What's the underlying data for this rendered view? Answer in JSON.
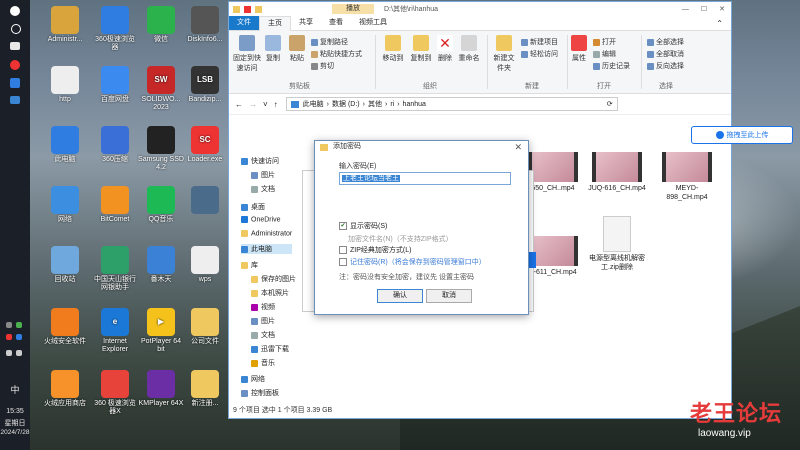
{
  "desktop_icons": [
    {
      "label": "Administr...",
      "color": "#d9a43b",
      "glyph": ""
    },
    {
      "label": "360极速浏览器",
      "color": "#2f7de1",
      "glyph": ""
    },
    {
      "label": "微信",
      "color": "#2bb24c",
      "glyph": ""
    },
    {
      "label": "DiskInfo6...",
      "color": "#555",
      "glyph": ""
    },
    {
      "label": "http",
      "color": "#eee",
      "glyph": ""
    },
    {
      "label": "百度网盘",
      "color": "#3b8af0",
      "glyph": ""
    },
    {
      "label": "SOLIDWO... 2023",
      "color": "#c62828",
      "glyph": "SW"
    },
    {
      "label": "Bandizip...",
      "color": "#333",
      "glyph": "LSB"
    },
    {
      "label": "此电脑",
      "color": "#2f7de1",
      "glyph": ""
    },
    {
      "label": "360压缩",
      "color": "#3a6fd8",
      "glyph": ""
    },
    {
      "label": "Samsung SSD 4.2",
      "color": "#222",
      "glyph": ""
    },
    {
      "label": "Loader.exe",
      "color": "#e33",
      "glyph": "SC"
    },
    {
      "label": "网络",
      "color": "#3c8ee0",
      "glyph": ""
    },
    {
      "label": "BitComet",
      "color": "#f29220",
      "glyph": ""
    },
    {
      "label": "QQ音乐",
      "color": "#1db954",
      "glyph": ""
    },
    {
      "label": "",
      "color": "#4a6b8a",
      "glyph": ""
    },
    {
      "label": "回收站",
      "color": "#6fa8dc",
      "glyph": ""
    },
    {
      "label": "中国天山银行网银助手",
      "color": "#2da06a",
      "glyph": ""
    },
    {
      "label": "番木天",
      "color": "#3b82d6",
      "glyph": ""
    },
    {
      "label": "wps",
      "color": "#eee",
      "glyph": ""
    },
    {
      "label": "火绒安全软件",
      "color": "#f07c1e",
      "glyph": ""
    },
    {
      "label": "Internet Explorer",
      "color": "#1b78d6",
      "glyph": "e"
    },
    {
      "label": "PotPlayer 64 bit",
      "color": "#f4c21b",
      "glyph": "▶"
    },
    {
      "label": "公司文件",
      "color": "#f0c860",
      "glyph": ""
    },
    {
      "label": "火绒应用商店",
      "color": "#f7922b",
      "glyph": ""
    },
    {
      "label": "360 极速浏览器X",
      "color": "#e8433a",
      "glyph": ""
    },
    {
      "label": "KMPlayer 64X",
      "color": "#6c2ea5",
      "glyph": ""
    },
    {
      "label": "新注册...",
      "color": "#f0c860",
      "glyph": ""
    }
  ],
  "taskbar": {
    "lang": "中",
    "time": "15:35",
    "weekday": "星期日",
    "date": "2024/7/28"
  },
  "explorer": {
    "title_path": "D:\\其他\\ri\\hanhua",
    "context_tab": "播放",
    "tabs": [
      "文件",
      "主页",
      "共享",
      "查看",
      "视频工具"
    ],
    "ribbon": {
      "pin": "固定到快速访问",
      "copy": "复制",
      "paste": "粘贴",
      "copy_path": "复制路径",
      "paste_shortcut": "粘贴快捷方式",
      "cut": "剪切",
      "clipboard": "剪贴板",
      "move_to": "移动到",
      "copy_to": "复制到",
      "delete": "删除",
      "rename": "重命名",
      "organize": "组织",
      "new_folder": "新建文件夹",
      "new_item": "新建项目",
      "easy_access": "轻松访问",
      "new": "新建",
      "properties": "属性",
      "open": "打开",
      "edit": "编辑",
      "history": "历史记录",
      "open_group": "打开",
      "select_all": "全部选择",
      "select_none": "全部取消",
      "invert": "反向选择",
      "select": "选择"
    },
    "breadcrumb": [
      "此电脑",
      "数据 (D:)",
      "其他",
      "ri",
      "hanhua"
    ],
    "search_button": "拖拽至此上传",
    "nav": [
      "快速访问",
      "图片",
      "文档",
      "桌面",
      "OneDrive",
      "Administrator",
      "此电脑",
      "库",
      "保存的图片",
      "本机照片",
      "视频",
      "图片",
      "文档",
      "迅雷下载",
      "音乐",
      "网络",
      "控制面板"
    ],
    "files": [
      {
        "name": "550_CH..mp4"
      },
      {
        "name": "JUQ-616_CH.mp4"
      },
      {
        "name": "MEYD-898_CH.mp4"
      },
      {
        "name": "V-611_CH.mp4"
      },
      {
        "name": "电源型离线机解密工.zip删除"
      }
    ],
    "status": "9 个项目   选中 1 个项目  3.39 GB"
  },
  "dialog": {
    "title": "添加密码",
    "label_password": "输入密码(E)",
    "password_value": "上老王论坛当老王",
    "show_password": "显示密码(S)",
    "encrypt_names": "加密文件名(N)（不支持ZIP格式）",
    "zip_classic": "ZIP经典加密方式(L)",
    "remember": "记住密码(R)（将会保存到密码管理窗口中）",
    "note": "注：密码没有安全加密，建议先 设置主密码",
    "ok": "确认",
    "cancel": "取消"
  },
  "watermark": {
    "cn": "老王论坛",
    "url": "laowang.vip"
  }
}
